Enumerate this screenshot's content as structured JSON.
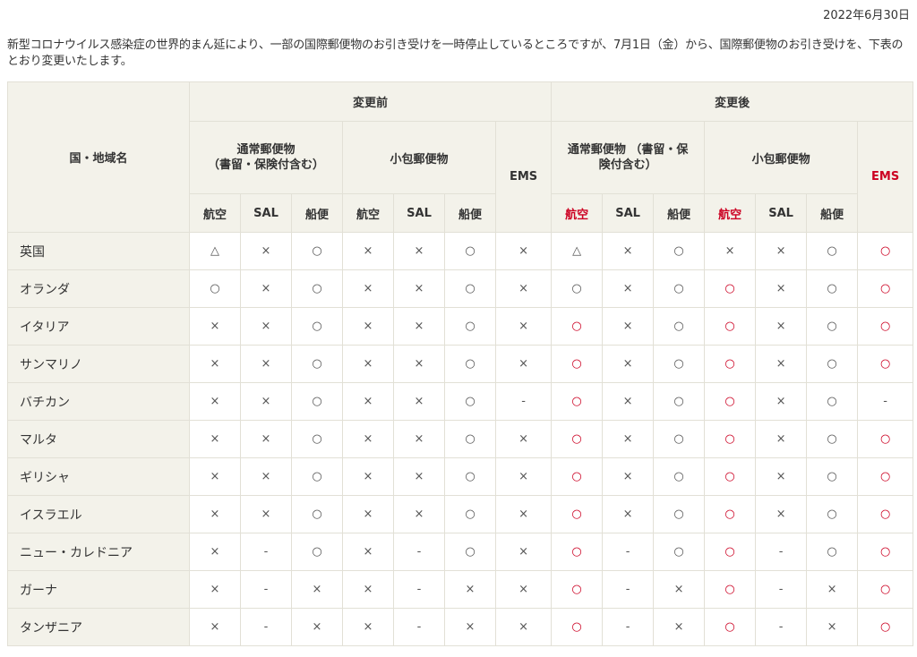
{
  "date": "2022年6月30日",
  "intro": "新型コロナウイルス感染症の世界的まん延により、一部の国際郵便物のお引き受けを一時停止しているところですが、7月1日（金）から、国際郵便物のお引き受けを、下表のとおり変更いたします。",
  "table": {
    "country_header": "国・地域名",
    "before_header": "変更前",
    "after_header": "変更後",
    "before_ordinary": "通常郵便物\n（書留・保険付含む）",
    "after_ordinary": "通常郵便物\n（書留・保険付含む）",
    "small_packet": "小包郵便物",
    "ems": "EMS",
    "air": "航空",
    "sal": "SAL",
    "sea": "船便"
  },
  "colors": {
    "header_bg": "#f3f2ea",
    "border": "#e2e0d6",
    "changed": "#cc0022"
  },
  "rows": [
    {
      "country": "英国",
      "cells": [
        "△",
        "×",
        "○",
        "×",
        "×",
        "○",
        "×",
        "△",
        "×",
        "○",
        "×",
        "×",
        "○",
        "○"
      ]
    },
    {
      "country": "オランダ",
      "cells": [
        "○",
        "×",
        "○",
        "×",
        "×",
        "○",
        "×",
        "○",
        "×",
        "○",
        "○",
        "×",
        "○",
        "○"
      ]
    },
    {
      "country": "イタリア",
      "cells": [
        "×",
        "×",
        "○",
        "×",
        "×",
        "○",
        "×",
        "○",
        "×",
        "○",
        "○",
        "×",
        "○",
        "○"
      ]
    },
    {
      "country": "サンマリノ",
      "cells": [
        "×",
        "×",
        "○",
        "×",
        "×",
        "○",
        "×",
        "○",
        "×",
        "○",
        "○",
        "×",
        "○",
        "○"
      ]
    },
    {
      "country": "バチカン",
      "cells": [
        "×",
        "×",
        "○",
        "×",
        "×",
        "○",
        "-",
        "○",
        "×",
        "○",
        "○",
        "×",
        "○",
        "-"
      ]
    },
    {
      "country": "マルタ",
      "cells": [
        "×",
        "×",
        "○",
        "×",
        "×",
        "○",
        "×",
        "○",
        "×",
        "○",
        "○",
        "×",
        "○",
        "○"
      ]
    },
    {
      "country": "ギリシャ",
      "cells": [
        "×",
        "×",
        "○",
        "×",
        "×",
        "○",
        "×",
        "○",
        "×",
        "○",
        "○",
        "×",
        "○",
        "○"
      ]
    },
    {
      "country": "イスラエル",
      "cells": [
        "×",
        "×",
        "○",
        "×",
        "×",
        "○",
        "×",
        "○",
        "×",
        "○",
        "○",
        "×",
        "○",
        "○"
      ]
    },
    {
      "country": "ニュー・カレドニア",
      "cells": [
        "×",
        "-",
        "○",
        "×",
        "-",
        "○",
        "×",
        "○",
        "-",
        "○",
        "○",
        "-",
        "○",
        "○"
      ]
    },
    {
      "country": "ガーナ",
      "cells": [
        "×",
        "-",
        "×",
        "×",
        "-",
        "×",
        "×",
        "○",
        "-",
        "×",
        "○",
        "-",
        "×",
        "○"
      ]
    },
    {
      "country": "タンザニア",
      "cells": [
        "×",
        "-",
        "×",
        "×",
        "-",
        "×",
        "×",
        "○",
        "-",
        "×",
        "○",
        "-",
        "×",
        "○"
      ]
    }
  ]
}
